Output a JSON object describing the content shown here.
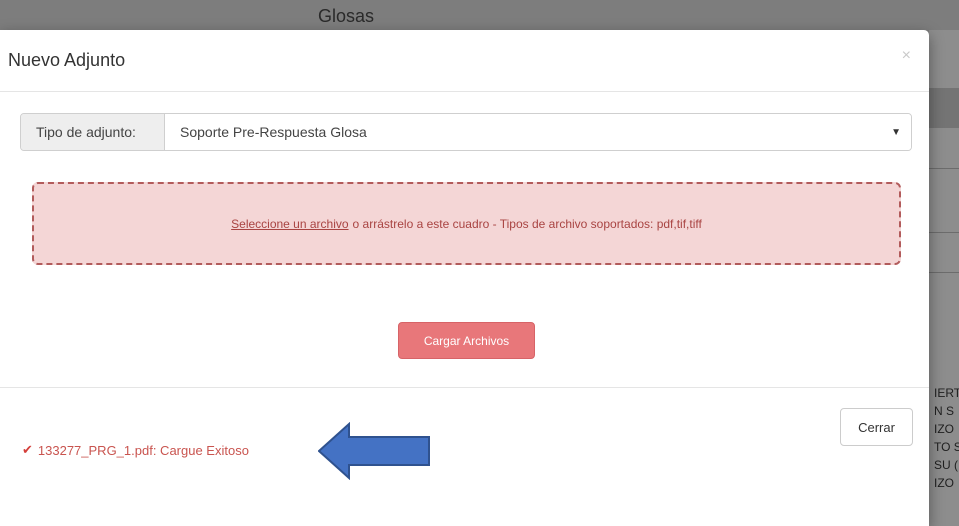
{
  "background": {
    "title": "Glosas",
    "snippets": [
      "IERT",
      "N S",
      "IZO",
      "TO S",
      "SU (",
      "IZO"
    ]
  },
  "modal": {
    "title": "Nuevo Adjunto",
    "close_icon": "×",
    "type_label": "Tipo de adjunto:",
    "type_value": "Soporte Pre-Respuesta Glosa",
    "dropzone": {
      "link_text": "Seleccione un archivo",
      "rest_text": "o arrástrelo a este cuadro - Tipos de archivo soportados: pdf,tif,tiff"
    },
    "upload_button": "Cargar Archivos",
    "status": {
      "icon": "check-icon",
      "message": "133277_PRG_1.pdf: Cargue Exitoso"
    },
    "close_button": "Cerrar"
  },
  "colors": {
    "accent_red": "#e8777a",
    "dropzone_bg": "#f4d6d6",
    "status_text": "#c9544f",
    "arrow_blue": "#4472c4"
  }
}
